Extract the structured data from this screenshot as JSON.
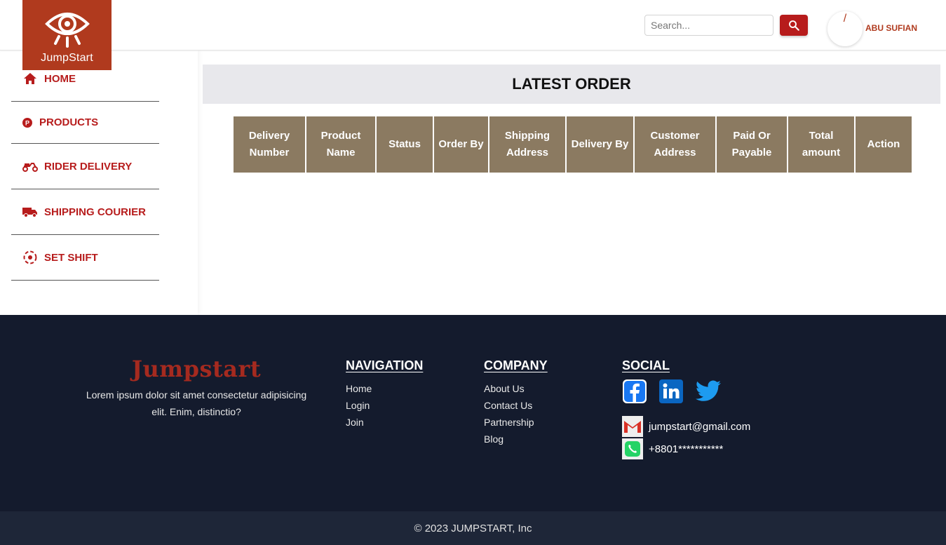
{
  "brand": {
    "logo_text": "JumpStart"
  },
  "search": {
    "placeholder": "Search..."
  },
  "user": {
    "avatar_glyph": "/",
    "name": "ABU SUFIAN"
  },
  "sidebar": {
    "items": [
      {
        "label": "HOME",
        "icon": "home-icon"
      },
      {
        "label": "PRODUCTS",
        "icon": "products-icon"
      },
      {
        "label": "RIDER DELIVERY",
        "icon": "scooter-icon"
      },
      {
        "label": "SHIPPING COURIER",
        "icon": "truck-icon"
      },
      {
        "label": "SET SHIFT",
        "icon": "shift-icon"
      }
    ]
  },
  "main": {
    "title": "LATEST ORDER",
    "columns": [
      "Delivery Number",
      "Product Name",
      "Status",
      "Order By",
      "Shipping Address",
      "Delivery By",
      "Customer Address",
      "Paid Or Payable",
      "Total amount",
      "Action"
    ]
  },
  "footer": {
    "brand_name": "Jumpstart",
    "description": "Lorem ipsum dolor sit amet consectetur adipisicing elit. Enim, distinctio?",
    "navigation": {
      "title": "NAVIGATION",
      "links": [
        "Home",
        "Login",
        "Join"
      ]
    },
    "company": {
      "title": "COMPANY",
      "links": [
        "About Us",
        "Contact Us",
        "Partnership",
        "Blog"
      ]
    },
    "social": {
      "title": "SOCIAL",
      "email": "jumpstart@gmail.com",
      "phone": "+8801***********"
    },
    "copyright": "© 2023 JUMPSTART, Inc"
  },
  "colors": {
    "brand": "#b03a1e",
    "accent": "#b71c1c",
    "table_header": "#8b7a61",
    "footer_bg": "#141b2d"
  }
}
